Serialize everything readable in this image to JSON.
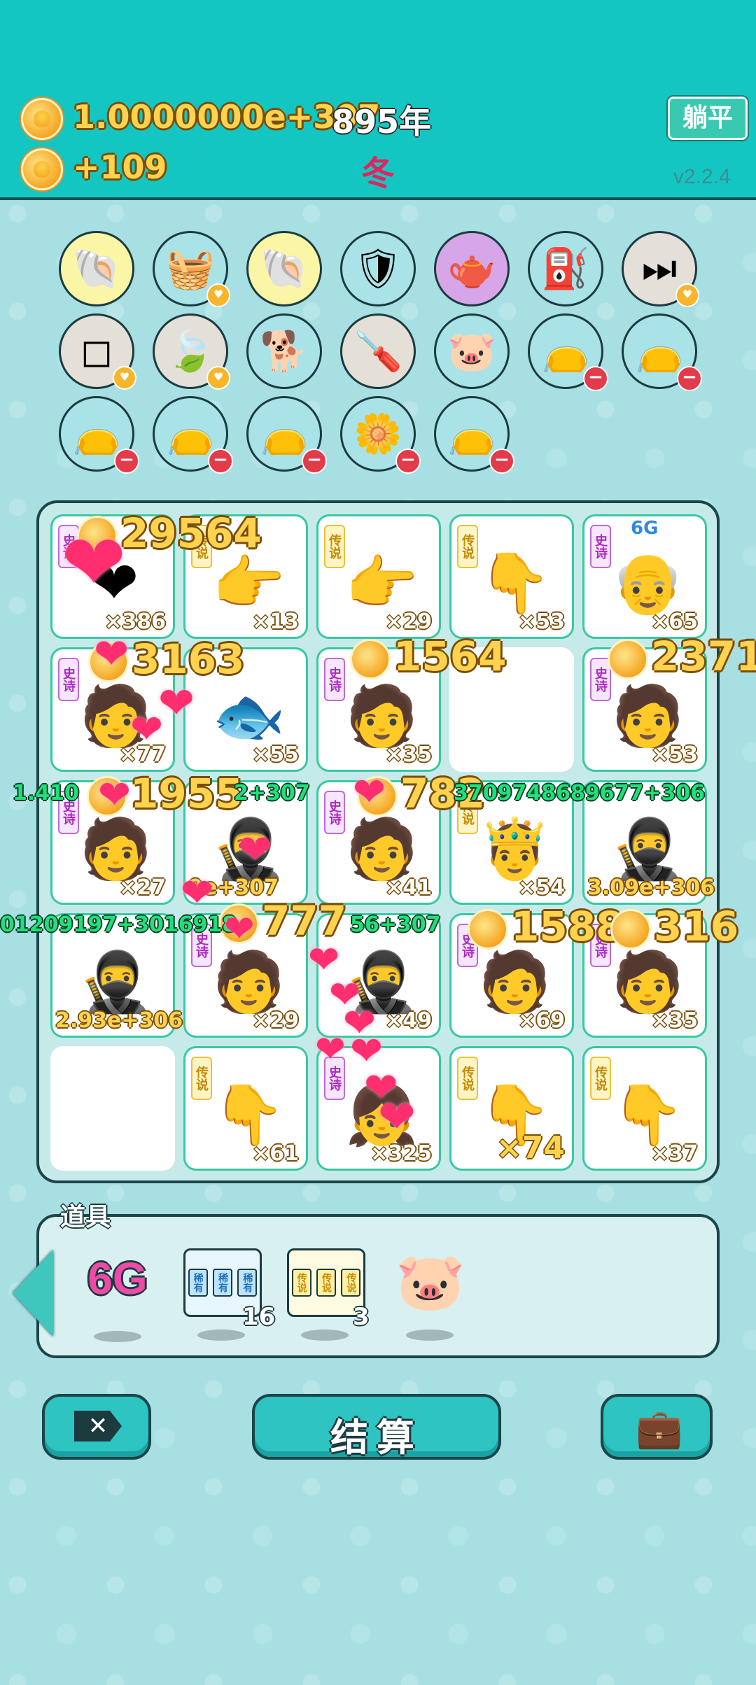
{
  "header": {
    "coins_total": "1.0000000e+307",
    "year": "895年",
    "coins_rate": "+109",
    "season": "冬",
    "flat_button": "躺平",
    "version": "v2.2.4"
  },
  "items": [
    {
      "icon": "shell-icon",
      "glyph": "🐚",
      "bg": "#fbf6a6",
      "badge": null
    },
    {
      "icon": "fruit-basket-icon",
      "glyph": "🧺",
      "bg": "#a9e3e8",
      "badge": "heart"
    },
    {
      "icon": "shell-icon",
      "glyph": "🐚",
      "bg": "#fbf6a6",
      "badge": null
    },
    {
      "icon": "shield-wrench-icon",
      "glyph": "🛡",
      "bg": "#a9e3e8",
      "badge": null
    },
    {
      "icon": "gravy-boat-icon",
      "glyph": "🫖",
      "bg": "#d6a6e8",
      "badge": null
    },
    {
      "icon": "bike-pump-icon",
      "glyph": "⛽",
      "bg": "#a9e3e8",
      "badge": null
    },
    {
      "icon": "skip-icon",
      "glyph": "⏭",
      "bg": "#e4e0d8",
      "badge": "heart"
    },
    {
      "icon": "sugar-cubes-icon",
      "glyph": "◻",
      "bg": "#e4e0d8",
      "badge": "heart"
    },
    {
      "icon": "leaf-icon",
      "glyph": "🍃",
      "bg": "#e4e0d8",
      "badge": "heart"
    },
    {
      "icon": "dog-sunglasses-icon",
      "glyph": "🐕",
      "bg": "#a9e3e8",
      "badge": null
    },
    {
      "icon": "screwdriver-icon",
      "glyph": "🪛",
      "bg": "#e4e0d8",
      "badge": null
    },
    {
      "icon": "piggy-bank-icon",
      "glyph": "🐷",
      "bg": "#a9e3e8",
      "badge": null
    },
    {
      "icon": "sack-icon",
      "glyph": "👝",
      "bg": "#a9e3e8",
      "badge": "minus"
    },
    {
      "icon": "sack-icon",
      "glyph": "👝",
      "bg": "#a9e3e8",
      "badge": "minus"
    },
    {
      "icon": "sack-icon",
      "glyph": "👝",
      "bg": "#a9e3e8",
      "badge": "minus"
    },
    {
      "icon": "sack-icon",
      "glyph": "👝",
      "bg": "#a9e3e8",
      "badge": "minus"
    },
    {
      "icon": "sack-icon",
      "glyph": "👝",
      "bg": "#a9e3e8",
      "badge": "minus"
    },
    {
      "icon": "flower-pot-icon",
      "glyph": "🌼",
      "bg": "#a9e3e8",
      "badge": "minus"
    },
    {
      "icon": "sack-icon",
      "glyph": "👝",
      "bg": "#a9e3e8",
      "badge": "minus"
    }
  ],
  "board": [
    [
      {
        "tag": "史诗",
        "tagType": "epic",
        "icon": "heart-icon",
        "glyph": "❤",
        "count": "×386"
      },
      {
        "tag": "传说",
        "tagType": "legend",
        "icon": "pointing-hand-icon",
        "glyph": "👉",
        "count": "×13"
      },
      {
        "tag": "传说",
        "tagType": "legend",
        "icon": "pointing-hand-icon",
        "glyph": "👉",
        "count": "×29"
      },
      {
        "tag": "传说",
        "tagType": "legend",
        "icon": "pointing-hand-icon",
        "glyph": "👇",
        "count": "×53"
      },
      {
        "tag": "史诗",
        "tagType": "epic",
        "icon": "king-6g-icon",
        "glyph": "👴",
        "count": "×65",
        "topLabel": "6G"
      }
    ],
    [
      {
        "tag": "史诗",
        "tagType": "epic",
        "icon": "green-hat-face-icon",
        "glyph": "🧑",
        "count": "×77"
      },
      {
        "tag": "",
        "tagType": "",
        "icon": "koi-fish-icon",
        "glyph": "🐟",
        "count": "×55"
      },
      {
        "tag": "史诗",
        "tagType": "epic",
        "icon": "green-hat-face-icon",
        "glyph": "🧑",
        "count": "×35"
      },
      {
        "tag": "",
        "tagType": "",
        "icon": "",
        "glyph": "",
        "count": "",
        "empty": true
      },
      {
        "tag": "史诗",
        "tagType": "epic",
        "icon": "green-hat-face-icon",
        "glyph": "🧑",
        "count": "×53"
      }
    ],
    [
      {
        "tag": "史诗",
        "tagType": "epic",
        "icon": "green-hat-face-icon",
        "glyph": "🧑",
        "count": "×27"
      },
      {
        "tag": "",
        "tagType": "",
        "icon": "thief-icon",
        "glyph": "🥷",
        "count": "9e+307"
      },
      {
        "tag": "史诗",
        "tagType": "epic",
        "icon": "green-hat-face-icon",
        "glyph": "🧑",
        "count": "×41"
      },
      {
        "tag": "传说",
        "tagType": "legend",
        "icon": "king-laugh-icon",
        "glyph": "🤴",
        "count": "×54"
      },
      {
        "tag": "",
        "tagType": "",
        "icon": "thief-icon",
        "glyph": "🥷",
        "count": "3.09e+306"
      }
    ],
    [
      {
        "tag": "",
        "tagType": "",
        "icon": "thief-icon",
        "glyph": "🥷",
        "count": "2.93e+306"
      },
      {
        "tag": "史诗",
        "tagType": "epic",
        "icon": "green-hat-face-icon",
        "glyph": "🧑",
        "count": "×29"
      },
      {
        "tag": "",
        "tagType": "",
        "icon": "thief-icon",
        "glyph": "🥷",
        "count": "×49"
      },
      {
        "tag": "史诗",
        "tagType": "epic",
        "icon": "green-hat-face-icon",
        "glyph": "🧑",
        "count": "×69"
      },
      {
        "tag": "史诗",
        "tagType": "epic",
        "icon": "green-hat-face-icon",
        "glyph": "🧑",
        "count": "×35"
      }
    ],
    [
      {
        "tag": "",
        "tagType": "",
        "icon": "",
        "glyph": "",
        "count": "",
        "empty": true
      },
      {
        "tag": "传说",
        "tagType": "legend",
        "icon": "crowned-hand-icon",
        "glyph": "👇",
        "count": "×61"
      },
      {
        "tag": "史诗",
        "tagType": "epic",
        "icon": "girl-braids-icon",
        "glyph": "👧",
        "count": "×325"
      },
      {
        "tag": "传说",
        "tagType": "legend",
        "icon": "pointing-hand-icon",
        "glyph": "👇",
        "count": "×74"
      },
      {
        "tag": "传说",
        "tagType": "legend",
        "icon": "pointing-hand-icon",
        "glyph": "👇",
        "count": "×37"
      }
    ]
  ],
  "floats": {
    "gold": [
      "29564",
      "3163",
      "1564",
      "2371",
      "1955",
      "782",
      "777",
      "1588",
      "316"
    ],
    "green": [
      "1.410",
      "2+307",
      "3709748689677+306",
      "01209197+3016918",
      "56+307"
    ]
  },
  "props": {
    "title": "道具",
    "items": [
      {
        "icon": "6g-icon",
        "label": "6G",
        "count": ""
      },
      {
        "icon": "epic-cards-icon",
        "label": "",
        "count": "16",
        "cards": [
          "稀有",
          "稀有",
          "稀有"
        ]
      },
      {
        "icon": "legend-cards-icon",
        "label": "",
        "count": "3",
        "cards": [
          "传说",
          "传说",
          "传说"
        ]
      },
      {
        "icon": "piggy-bank-icon",
        "label": "",
        "count": ""
      }
    ]
  },
  "bottom": {
    "settle_label": "结算"
  }
}
